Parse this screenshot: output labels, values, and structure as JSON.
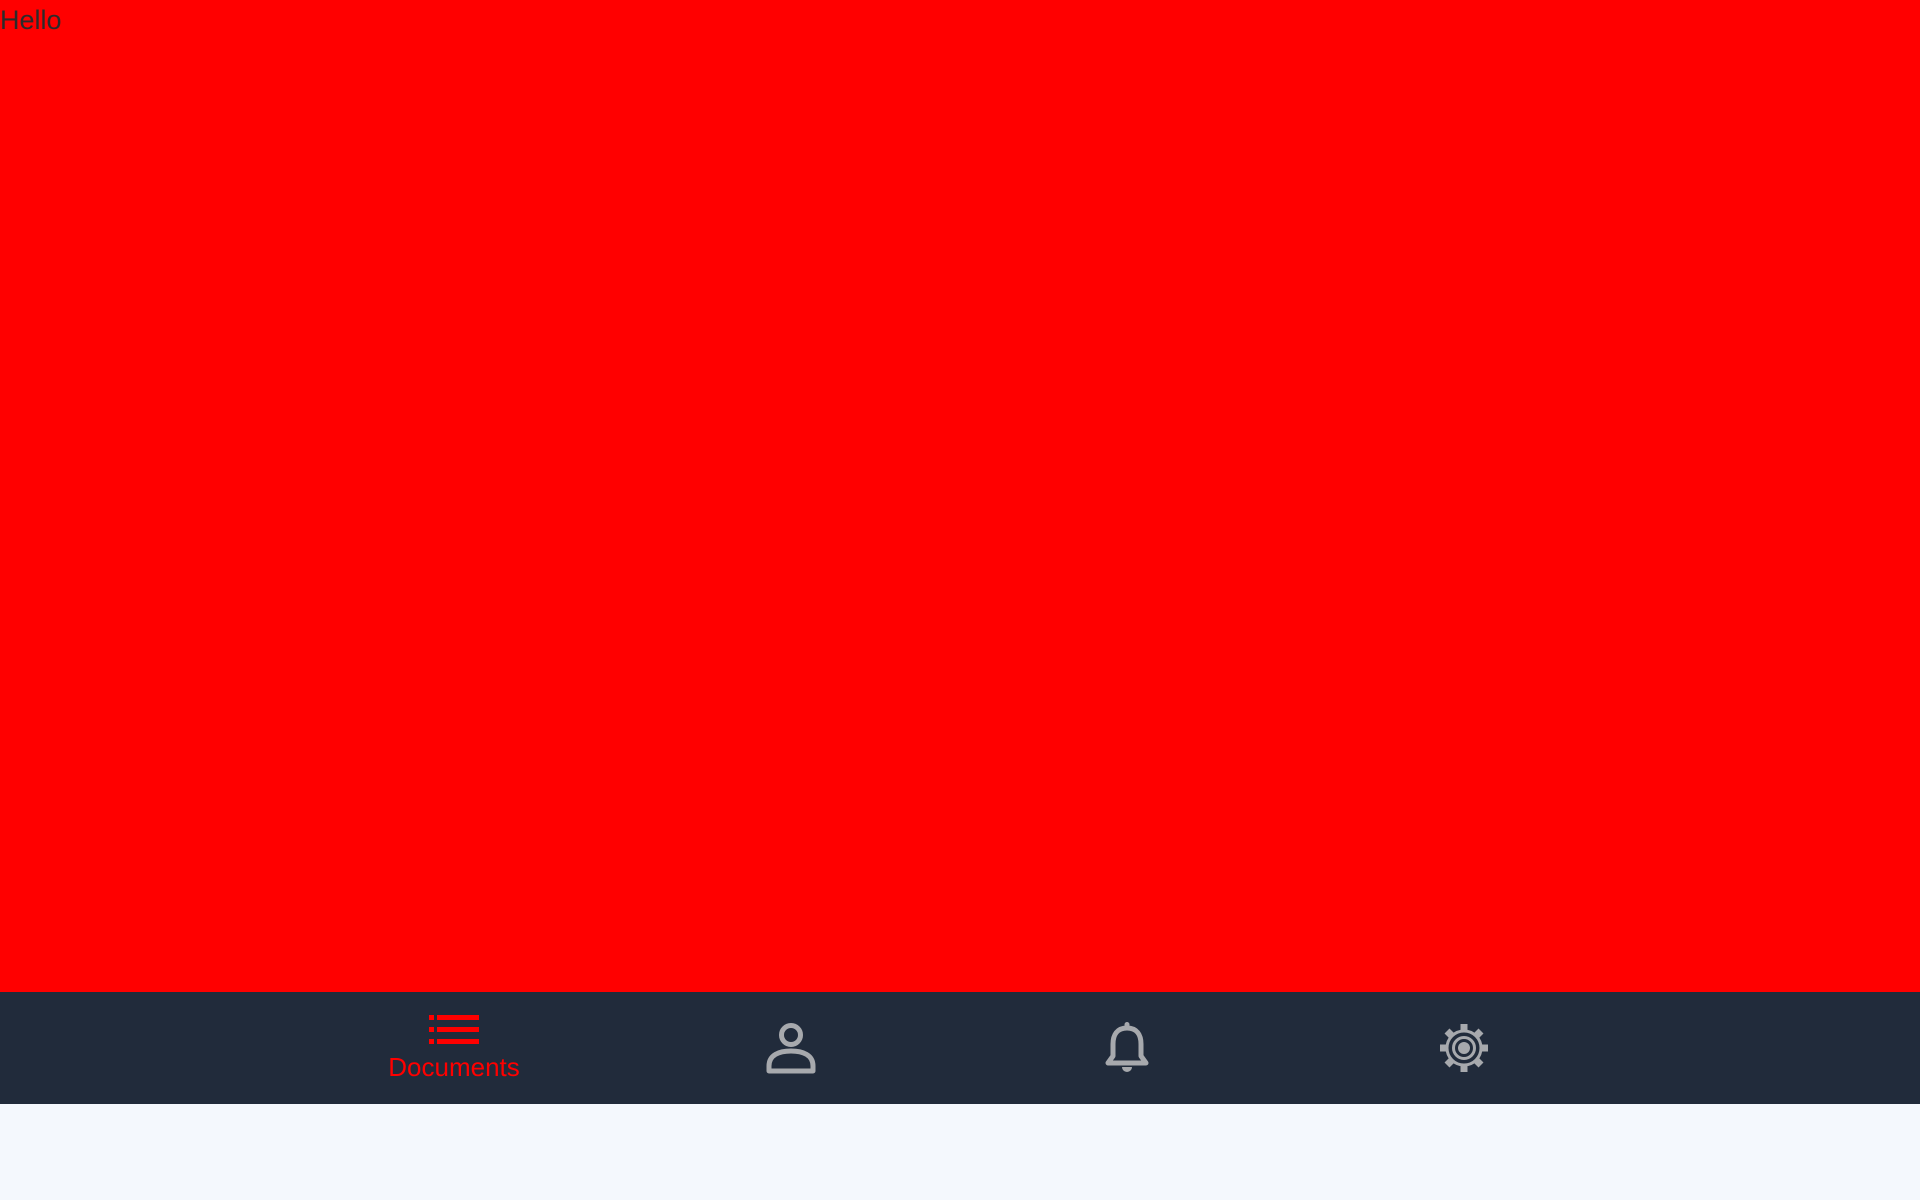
{
  "content": {
    "text": "Hello"
  },
  "tabbar": {
    "tabs": [
      {
        "id": "documents",
        "label": "Documents",
        "icon": "list-icon",
        "active": true
      },
      {
        "id": "profile",
        "label": "",
        "icon": "person-icon",
        "active": false
      },
      {
        "id": "notifications",
        "label": "",
        "icon": "bell-icon",
        "active": false
      },
      {
        "id": "settings",
        "label": "",
        "icon": "gear-icon",
        "active": false
      }
    ]
  },
  "colors": {
    "content_background": "#ff0000",
    "tabbar_background": "#212b3b",
    "active_tab": "#ff0000",
    "inactive_tab": "#a7a9ad",
    "safe_area": "#f4f8fd",
    "content_text": "#2b2b2b"
  }
}
